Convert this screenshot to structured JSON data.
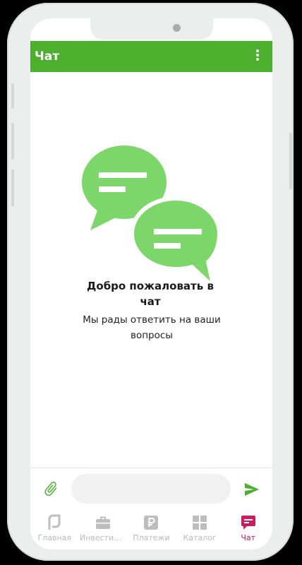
{
  "colors": {
    "accent": "#4caf2e",
    "bubble": "#7dd669",
    "active_nav": "#cc1a5c",
    "inactive_nav": "#b9b9b9"
  },
  "appbar": {
    "title": "Чат",
    "menu_icon": "more-vert-icon"
  },
  "empty_state": {
    "icon": "chat-bubbles-icon",
    "title": "Добро пожаловать в чат",
    "subtitle": "Мы рады ответить на ваши вопросы"
  },
  "composer": {
    "attach_icon": "paperclip-icon",
    "placeholder": "",
    "value": "",
    "send_icon": "send-icon"
  },
  "bottom_nav": {
    "items": [
      {
        "label": "Главная",
        "icon": "home-logo-icon",
        "active": false
      },
      {
        "label": "Инвестиц…",
        "icon": "briefcase-icon",
        "active": false
      },
      {
        "label": "Платежи",
        "icon": "ruble-icon",
        "active": false
      },
      {
        "label": "Каталог",
        "icon": "grid-icon",
        "active": false
      },
      {
        "label": "Чат",
        "icon": "chat-icon",
        "active": true
      }
    ]
  }
}
